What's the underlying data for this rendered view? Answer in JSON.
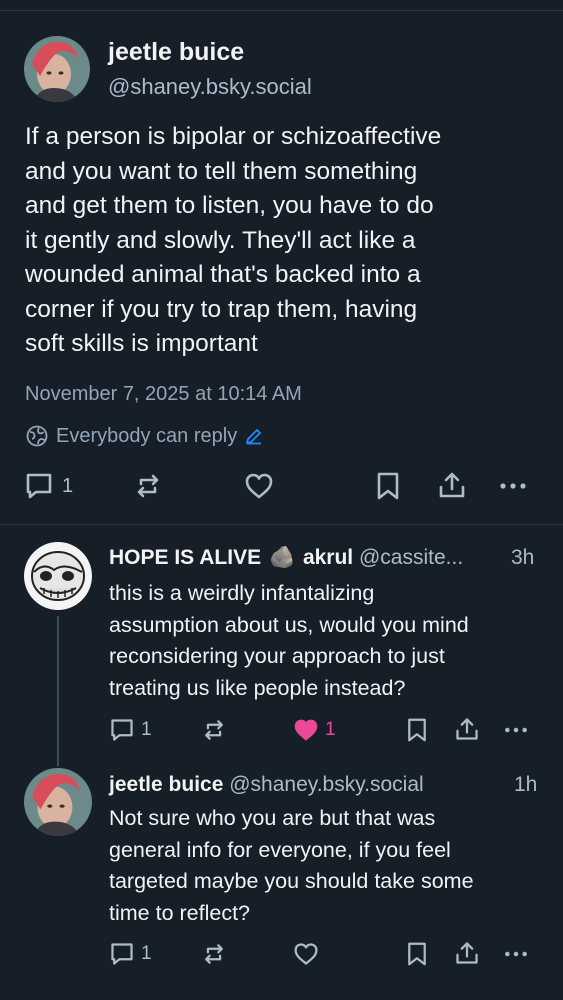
{
  "main_post": {
    "display_name": "jeetle buice",
    "handle": "@shaney.bsky.social",
    "text_lines": [
      "If a person is bipolar or schizoaffective",
      "and you want to tell them something",
      "and get them to listen, you have to do",
      "it gently and slowly. They'll act like a",
      "wounded animal that's backed into a",
      "corner if you try to trap them, having",
      "soft skills is important"
    ],
    "timestamp": "November 7, 2025 at 10:14 AM",
    "reply_setting": "Everybody can reply",
    "reply_count": "1",
    "repost_count": "",
    "like_count": ""
  },
  "replies": [
    {
      "display_name": "HOPE IS ALIVE",
      "emoji": "🪨",
      "name_suffix": "akrul",
      "handle": "@cassite...",
      "time": "3h",
      "text_lines": [
        "this is a weirdly infantalizing",
        "assumption about us, would you mind",
        "reconsidering your approach to just",
        "treating us like people instead?"
      ],
      "reply_count": "1",
      "like_count": "1",
      "liked": true
    },
    {
      "display_name": "jeetle buice",
      "handle": "@shaney.bsky.social",
      "time": "1h",
      "text_lines": [
        "Not sure who you are but that was",
        "general info for everyone, if you feel",
        "targeted maybe you should take some",
        "time to reflect?"
      ],
      "reply_count": "1",
      "like_count": "",
      "liked": false
    }
  ],
  "colors": {
    "background": "#161e27",
    "text": "#f1f3f5",
    "muted": "#93a5b7",
    "accent": "#208bfe",
    "like": "#ec4899"
  },
  "icons": [
    "globe-icon",
    "pencil-icon",
    "reply-icon",
    "repost-icon",
    "heart-icon",
    "bookmark-icon",
    "share-icon",
    "more-icon"
  ]
}
